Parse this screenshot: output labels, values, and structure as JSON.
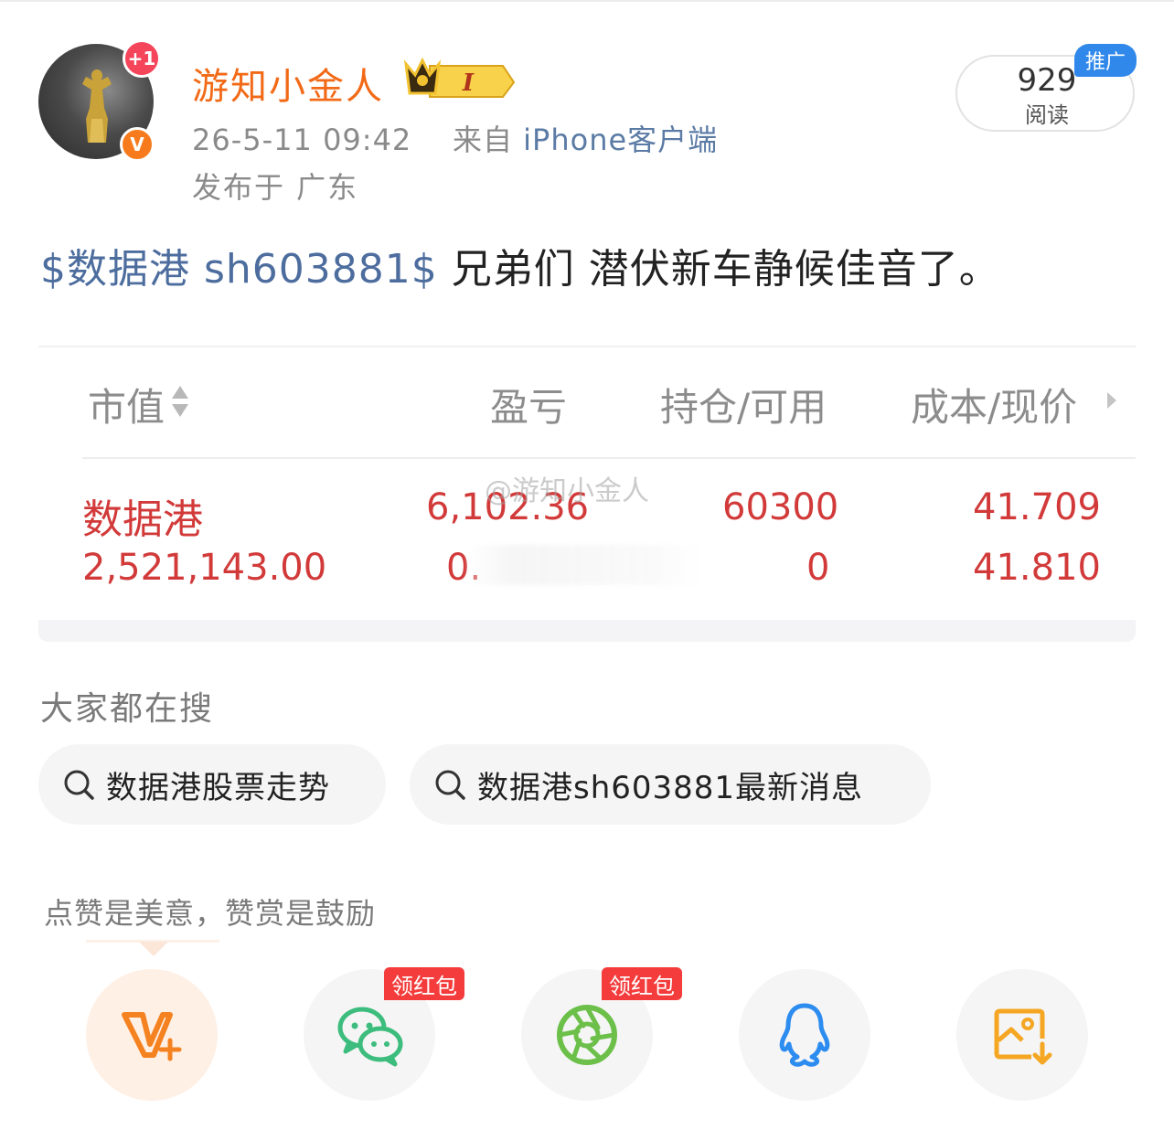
{
  "post_header": {
    "username": "游知小金人",
    "level_badge": "I",
    "notification_badge": "+1",
    "verified_badge": "V",
    "timestamp": "26-5-11 09:42",
    "source_prefix": "来自",
    "source_app": "iPhone客户端",
    "location": "发布于 广东",
    "read_count": "929",
    "read_label": "阅读",
    "promo_tag": "推广"
  },
  "post": {
    "stock_tag": "$数据港 sh603881$",
    "text": " 兄弟们 潜伏新车静候佳音了。"
  },
  "holding_card": {
    "columns": [
      "市值",
      "盈亏",
      "持仓/可用",
      "成本/现价"
    ],
    "row": {
      "name": "数据港",
      "market_value": "2,521,143.00",
      "profit": "6,102.36",
      "profit_ratio_partial": "0.",
      "position": "60300",
      "available": "0",
      "cost": "41.709",
      "price": "41.810"
    },
    "watermark": "@游知小金人"
  },
  "search": {
    "heading": "大家都在搜",
    "chips": [
      "数据港股票走势",
      "数据港sh603881最新消息"
    ]
  },
  "share": {
    "tip": "点赞是美意，赞赏是鼓励",
    "hongbao_label": "领红包",
    "buttons": [
      "reward-icon",
      "wechat-icon",
      "moments-icon",
      "qq-icon",
      "save-image-icon"
    ]
  },
  "colors": {
    "username": "#f26a17",
    "stock_tag": "#4d6d9e",
    "gain": "#d23a3a",
    "promo": "#2f88ea",
    "hongbao": "#f43c3c",
    "wechat": "#3dbd7d",
    "moments": "#6cc04a",
    "qq": "#2d8cf0",
    "save": "#f5a623"
  }
}
